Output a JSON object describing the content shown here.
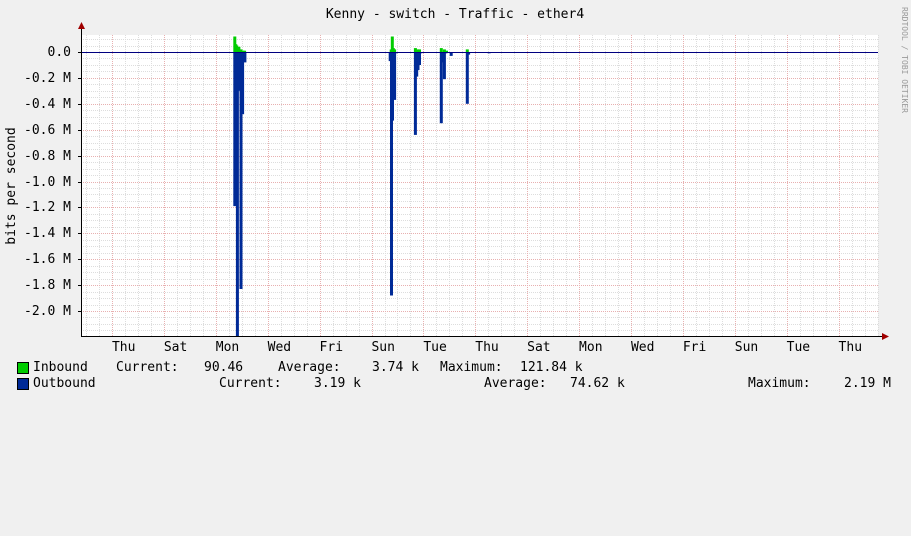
{
  "chart_data": {
    "type": "area",
    "title": "Kenny - switch - Traffic - ether4",
    "ylabel": "bits per second",
    "watermark": "RRDTOOL / TOBI OETIKER",
    "ylim": [
      -2.2,
      0.15
    ],
    "y_unit_scale": "M",
    "y_ticks": [
      0.0,
      -0.2,
      -0.4,
      -0.6,
      -0.8,
      -1.0,
      -1.2,
      -1.4,
      -1.6,
      -1.8,
      -2.0
    ],
    "y_tick_labels": [
      "0.0",
      "-0.2 M",
      "-0.4 M",
      "-0.6 M",
      "-0.8 M",
      "-1.0 M",
      "-1.2 M",
      "-1.4 M",
      "-1.6 M",
      "-1.8 M",
      "-2.0 M"
    ],
    "x_labels": [
      "Thu",
      "Sat",
      "Mon",
      "Wed",
      "Fri",
      "Sun",
      "Tue",
      "Thu",
      "Sat",
      "Mon",
      "Wed",
      "Fri",
      "Sun",
      "Tue",
      "Thu"
    ],
    "grid": true,
    "colors": {
      "inbound": "#00cc00",
      "outbound": "#002a97",
      "background": "#f0f0f0",
      "canvas": "#ffffff",
      "grid_minor": "#dddddd",
      "grid_major": "#e8b0b0",
      "axis": "#000000",
      "zero_line": "#000080",
      "arrow": "#a00000"
    },
    "series": [
      {
        "name": "Inbound",
        "x": [
          4.23,
          4.27,
          4.31,
          4.39,
          4.47,
          4.55,
          4.61,
          10.26,
          10.3,
          10.34,
          10.39,
          11.19,
          11.26,
          11.35,
          12.19,
          12.31,
          12.39,
          13.19
        ],
        "values": [
          0.12,
          0.06,
          0.05,
          0.04,
          0.02,
          0.01,
          0.01,
          0.02,
          0.12,
          0.03,
          0.02,
          0.03,
          0.02,
          0.02,
          0.03,
          0.02,
          0.01,
          0.02
        ]
      },
      {
        "name": "Outbound",
        "x": [
          4.23,
          4.27,
          4.33,
          4.39,
          4.47,
          4.53,
          4.58,
          4.62,
          10.22,
          10.27,
          10.31,
          10.35,
          10.39,
          10.45,
          11.19,
          11.24,
          11.29,
          11.35,
          11.4,
          12.19,
          12.25,
          12.31,
          12.37,
          12.57,
          13.19,
          13.24,
          14.03
        ],
        "values": [
          -1.19,
          -0.2,
          -2.2,
          -0.3,
          -1.83,
          -0.48,
          -0.03,
          -0.08,
          -0.07,
          -1.88,
          -0.53,
          -0.29,
          -0.37,
          -0.01,
          -0.64,
          -0.19,
          -0.14,
          -0.1,
          -0.01,
          -0.55,
          -0.08,
          -0.21,
          -0.01,
          -0.03,
          -0.4,
          -0.02,
          -0.01
        ]
      }
    ]
  },
  "legend": {
    "inbound": {
      "label": "Inbound",
      "current_label": "Current:",
      "current": "90.46",
      "average_label": "Average:",
      "average": "3.74 k",
      "maximum_label": "Maximum:",
      "maximum": "121.84 k"
    },
    "outbound": {
      "label": "Outbound",
      "current_label": "Current:",
      "current": "3.19 k",
      "average_label": "Average:",
      "average": "74.62 k",
      "maximum_label": "Maximum:",
      "maximum": "2.19 M"
    }
  }
}
